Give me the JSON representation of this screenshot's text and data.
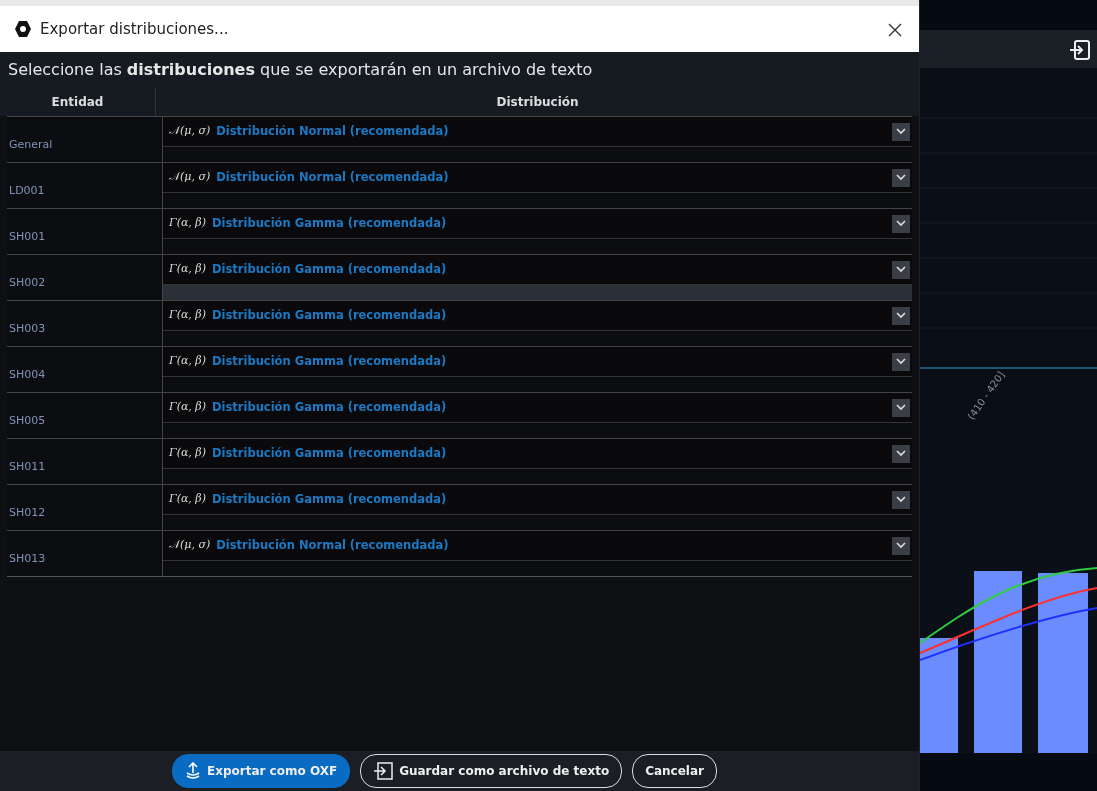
{
  "window": {
    "title": "Exportar distribuciones..."
  },
  "instruction": "Seleccione las **distribuciones** que se exportarán en un archivo de texto",
  "table": {
    "columns": [
      "Entidad",
      "Distribución"
    ],
    "rows": [
      {
        "entity": "General",
        "formula": "𝒩(μ, σ)",
        "distribution": "Distribución Normal (recomendada)",
        "highlighted": false
      },
      {
        "entity": "LD001",
        "formula": "𝒩(μ, σ)",
        "distribution": "Distribución Normal (recomendada)",
        "highlighted": false
      },
      {
        "entity": "SH001",
        "formula": "Γ(α, β)",
        "distribution": "Distribución Gamma (recomendada)",
        "highlighted": false
      },
      {
        "entity": "SH002",
        "formula": "Γ(α, β)",
        "distribution": "Distribución Gamma (recomendada)",
        "highlighted": true
      },
      {
        "entity": "SH003",
        "formula": "Γ(α, β)",
        "distribution": "Distribución Gamma (recomendada)",
        "highlighted": false
      },
      {
        "entity": "SH004",
        "formula": "Γ(α, β)",
        "distribution": "Distribución Gamma (recomendada)",
        "highlighted": false
      },
      {
        "entity": "SH005",
        "formula": "Γ(α, β)",
        "distribution": "Distribución Gamma (recomendada)",
        "highlighted": false
      },
      {
        "entity": "SH011",
        "formula": "Γ(α, β)",
        "distribution": "Distribución Gamma (recomendada)",
        "highlighted": false
      },
      {
        "entity": "SH012",
        "formula": "Γ(α, β)",
        "distribution": "Distribución Gamma (recomendada)",
        "highlighted": false
      },
      {
        "entity": "SH013",
        "formula": "𝒩(μ, σ)",
        "distribution": "Distribución Normal (recomendada)",
        "highlighted": false
      }
    ]
  },
  "buttons": [
    {
      "label": "Exportar como OXF",
      "kind": "primary"
    },
    {
      "label": "Guardar como archivo de texto",
      "kind": "outline-icon"
    },
    {
      "label": "Cancelar",
      "kind": "outline"
    }
  ],
  "background_app": {
    "bin_label": "(410 - 420]"
  }
}
